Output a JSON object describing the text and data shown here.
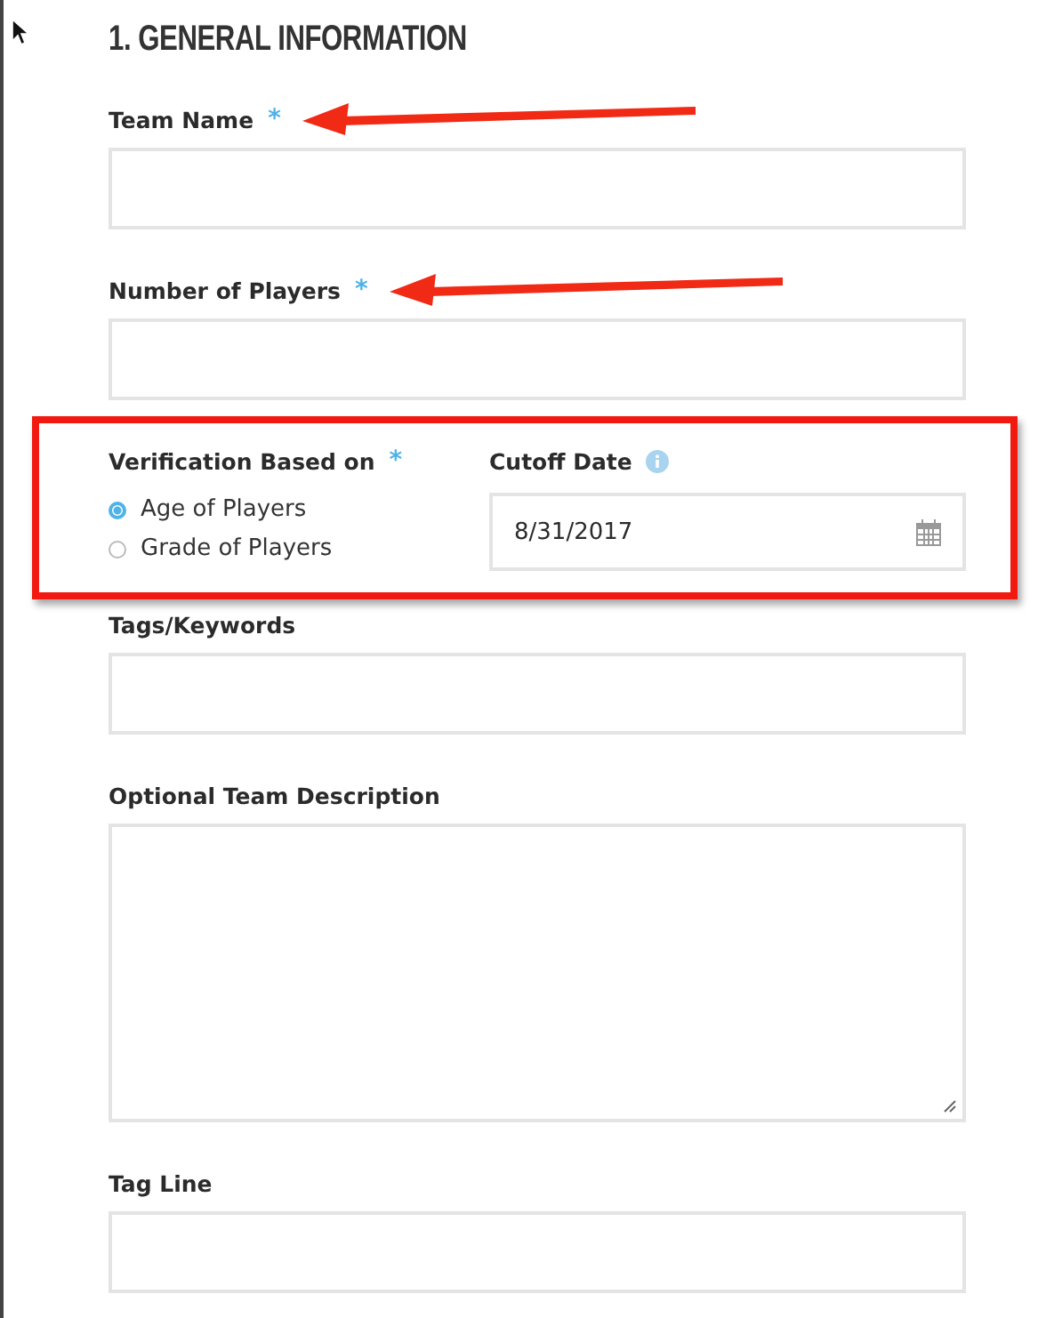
{
  "heading": "1. GENERAL INFORMATION",
  "fields": [
    {
      "kind": "text",
      "label": "Team Name",
      "required_mark": "*",
      "annotated": true
    },
    {
      "kind": "text",
      "label": "Number of Players",
      "required_mark": "*",
      "annotated": true
    },
    {
      "kind": "group",
      "highlighted": true,
      "verification": {
        "label": "Verification Based on",
        "required_mark": "*",
        "options": [
          {
            "label": "Age of Players",
            "selected": true
          },
          {
            "label": "Grade of Players",
            "selected": false
          }
        ]
      },
      "cutoff": {
        "label": "Cutoff Date",
        "value": "8/31/2017"
      }
    },
    {
      "kind": "text",
      "label": "Tags/Keywords",
      "annotated": false
    },
    {
      "kind": "textarea",
      "label": "Optional Team Description",
      "annotated": false
    },
    {
      "kind": "text",
      "label": "Tag Line",
      "annotated": false
    }
  ]
}
